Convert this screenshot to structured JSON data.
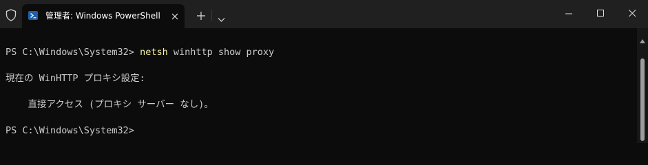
{
  "window": {
    "tab_title": "管理者: Windows PowerShell"
  },
  "terminal": {
    "prompt1": "PS C:\\Windows\\System32> ",
    "command1": "netsh",
    "command1_args": " winhttp show proxy",
    "output_line1": "現在の WinHTTP プロキシ設定:",
    "output_line2": "    直接アクセス (プロキシ サーバー なし)。",
    "prompt2": "PS C:\\Windows\\System32>"
  },
  "colors": {
    "background": "#0c0c0c",
    "titlebar": "#202020",
    "text": "#cccccc",
    "command_highlight": "#f9f1a5"
  },
  "icons": {
    "shield": "shield-icon",
    "powershell": "powershell-icon",
    "close": "close-icon",
    "new_tab": "plus-icon",
    "dropdown": "chevron-down-icon",
    "minimize": "minimize-icon",
    "maximize": "maximize-icon",
    "window_close": "window-close-icon"
  }
}
